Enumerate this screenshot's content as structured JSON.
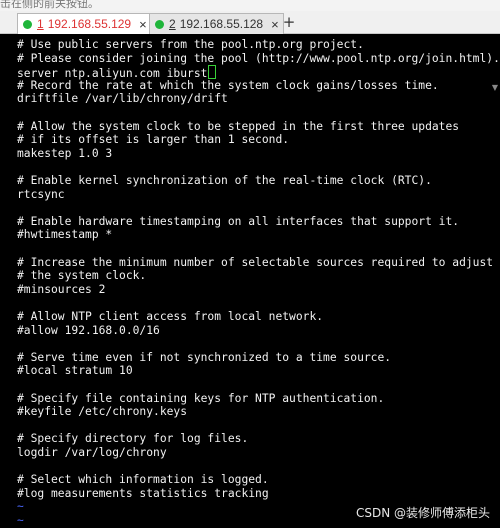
{
  "top_strip": {
    "text": "击在侧的前关按钮。"
  },
  "tabs": [
    {
      "number": "1",
      "label": "192.168.55.129",
      "active": true,
      "status_color": "#1fb53a"
    },
    {
      "number": "2",
      "label": "192.168.55.128",
      "active": false,
      "status_color": "#1fb53a"
    }
  ],
  "tab_close_glyph": "×",
  "new_tab_glyph": "+",
  "terminal": {
    "lines": [
      "# Use public servers from the pool.ntp.org project.",
      "# Please consider joining the pool (http://www.pool.ntp.org/join.html).",
      "server ntp.aliyun.com iburst",
      "# Record the rate at which the system clock gains/losses time.",
      "driftfile /var/lib/chrony/drift",
      "",
      "# Allow the system clock to be stepped in the first three updates",
      "# if its offset is larger than 1 second.",
      "makestep 1.0 3",
      "",
      "# Enable kernel synchronization of the real-time clock (RTC).",
      "rtcsync",
      "",
      "# Enable hardware timestamping on all interfaces that support it.",
      "#hwtimestamp *",
      "",
      "# Increase the minimum number of selectable sources required to adjust",
      "# the system clock.",
      "#minsources 2",
      "",
      "# Allow NTP client access from local network.",
      "#allow 192.168.0.0/16",
      "",
      "# Serve time even if not synchronized to a time source.",
      "#local stratum 10",
      "",
      "# Specify file containing keys for NTP authentication.",
      "#keyfile /etc/chrony.keys",
      "",
      "# Specify directory for log files.",
      "logdir /var/log/chrony",
      "",
      "# Select which information is logged.",
      "#log measurements statistics tracking",
      "~",
      "~"
    ],
    "text_color": "#f2f2f2",
    "tilde_color": "#4a68ff",
    "cursor_color": "#39d239"
  },
  "watermark": {
    "text": "CSDN @装修师傅添柜头"
  }
}
